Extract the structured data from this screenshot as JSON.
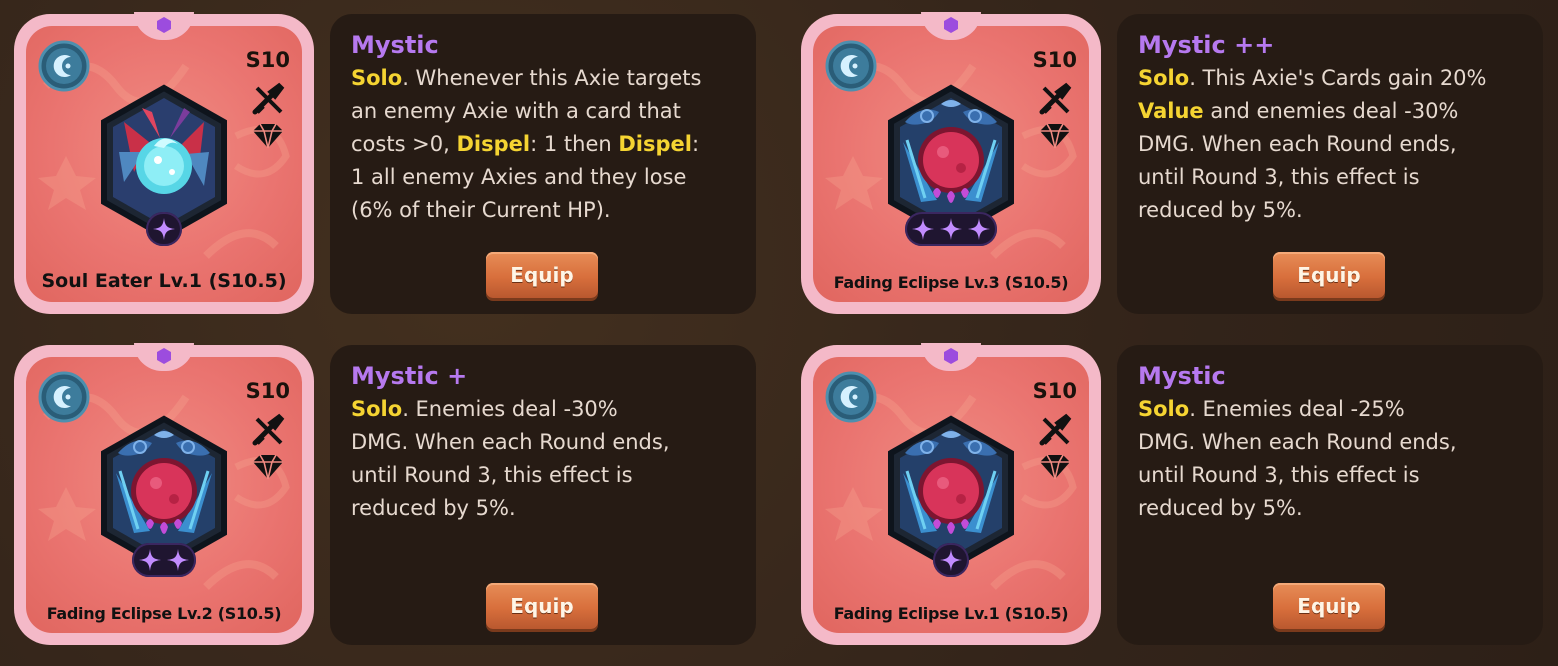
{
  "equip_label": "Equip",
  "colors": {
    "background": "#33241a",
    "panel": "#261b14",
    "card_border": "#f4b9c8",
    "card_fill": "#ea7470",
    "title_purple": "#b679ef",
    "keyword_yellow": "#f5d432",
    "body_text": "#e6d9cf",
    "equip_orange": "#d86f3c"
  },
  "items": [
    {
      "card": {
        "name": "Soul Eater Lv.1 (S10.5)",
        "season": "S10",
        "class_icon": "mystic-moon-icon",
        "art": "soul-eater-crystal-icon",
        "stars": 1
      },
      "title": "Mystic",
      "desc": [
        {
          "t": "Solo",
          "k": true
        },
        {
          "t": ". Whenever this Axie targets\nan enemy Axie with a card that\ncosts >0, ",
          "k": false
        },
        {
          "t": "Dispel",
          "k": true
        },
        {
          "t": ": 1 then ",
          "k": false
        },
        {
          "t": "Dispel",
          "k": true
        },
        {
          "t": ":\n1 all enemy Axies and they lose\n(6% of their Current HP).",
          "k": false
        }
      ]
    },
    {
      "card": {
        "name": "Fading Eclipse Lv.3 (S10.5)",
        "season": "S10",
        "class_icon": "mystic-moon-icon",
        "art": "fading-eclipse-moon-icon",
        "stars": 3
      },
      "title": "Mystic ++",
      "desc": [
        {
          "t": "Solo",
          "k": true
        },
        {
          "t": ". This Axie's Cards gain 20%\n",
          "k": false
        },
        {
          "t": "Value",
          "k": true
        },
        {
          "t": " and enemies deal -30%\nDMG. When each Round ends,\nuntil Round 3, this effect is\nreduced by 5%.",
          "k": false
        }
      ]
    },
    {
      "card": {
        "name": "Fading Eclipse Lv.2 (S10.5)",
        "season": "S10",
        "class_icon": "mystic-moon-icon",
        "art": "fading-eclipse-moon-icon",
        "stars": 2
      },
      "title": "Mystic +",
      "desc": [
        {
          "t": "Solo",
          "k": true
        },
        {
          "t": ". Enemies deal -30%\nDMG. When each Round ends,\nuntil Round 3, this effect is\nreduced by 5%.",
          "k": false
        }
      ]
    },
    {
      "card": {
        "name": "Fading Eclipse Lv.1 (S10.5)",
        "season": "S10",
        "class_icon": "mystic-moon-icon",
        "art": "fading-eclipse-moon-icon",
        "stars": 1
      },
      "title": "Mystic",
      "desc": [
        {
          "t": "Solo",
          "k": true
        },
        {
          "t": ". Enemies deal -25%\nDMG. When each Round ends,\nuntil Round 3, this effect is\nreduced by 5%.",
          "k": false
        }
      ]
    }
  ]
}
